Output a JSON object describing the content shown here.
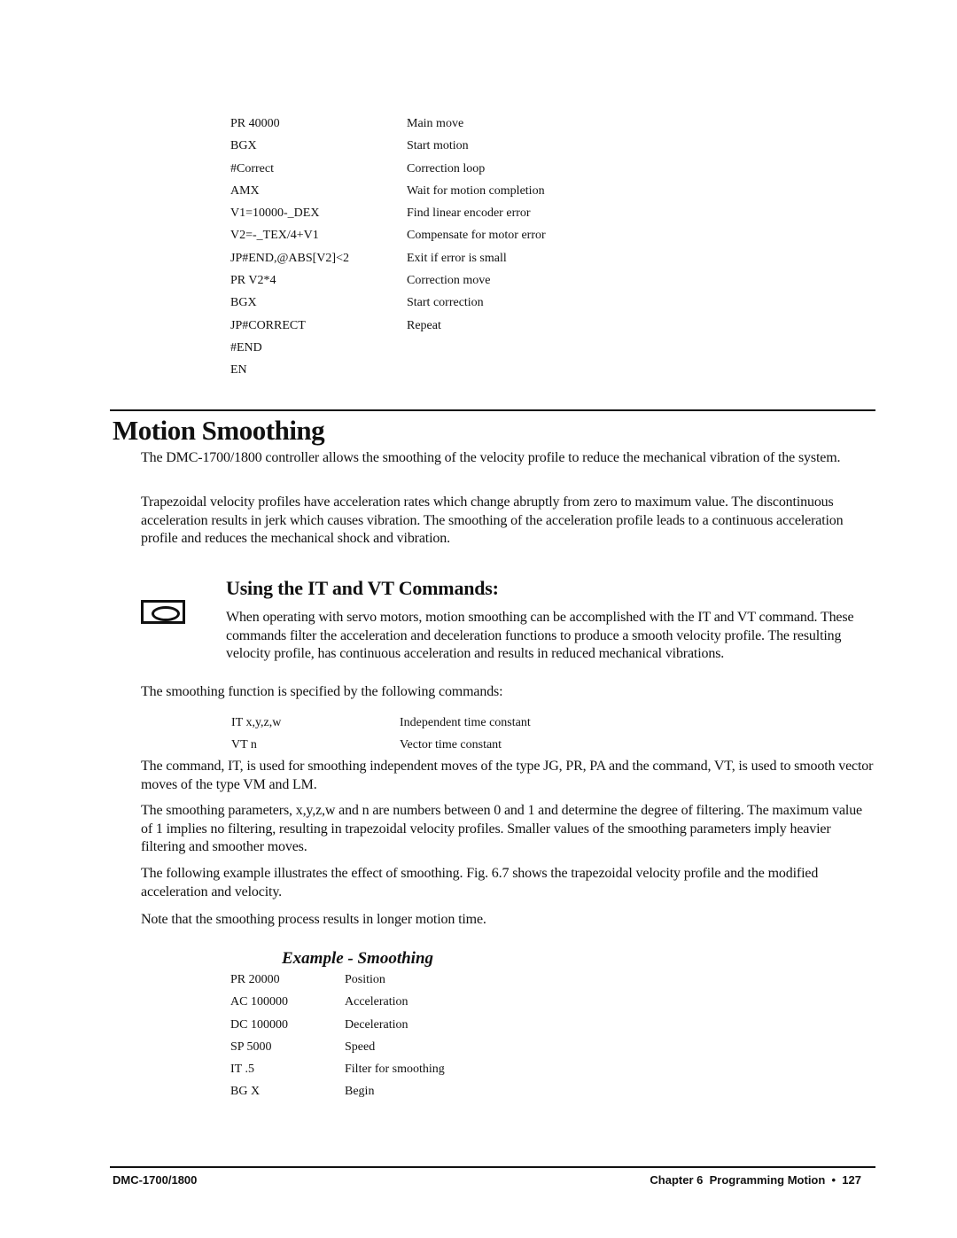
{
  "code_block_1": {
    "rows": [
      {
        "cmd": "PR 40000",
        "desc": "Main move"
      },
      {
        "cmd": "BGX",
        "desc": "Start motion"
      },
      {
        "cmd": "#Correct",
        "desc": "Correction loop"
      },
      {
        "cmd": "AMX",
        "desc": "Wait for motion completion"
      },
      {
        "cmd": "V1=10000-_DEX",
        "desc": "Find linear encoder error"
      },
      {
        "cmd": "V2=-_TEX/4+V1",
        "desc": "Compensate for motor error"
      },
      {
        "cmd": "JP#END,@ABS[V2]<2",
        "desc": "Exit if error is small"
      },
      {
        "cmd": "PR V2*4",
        "desc": "Correction move"
      },
      {
        "cmd": "BGX",
        "desc": "Start correction"
      },
      {
        "cmd": "JP#CORRECT",
        "desc": "Repeat"
      },
      {
        "cmd": "#END",
        "desc": ""
      },
      {
        "cmd": "EN",
        "desc": ""
      }
    ]
  },
  "section": {
    "title": "Motion Smoothing",
    "intro_paragraphs": [
      "The DMC-1700/1800 controller allows the smoothing of the velocity profile to reduce the mechanical vibration of the system.",
      "Trapezoidal velocity profiles have acceleration rates which change abruptly from zero to maximum value.  The discontinuous acceleration results in jerk which causes vibration.  The smoothing of the acceleration profile leads to a continuous acceleration profile and reduces the mechanical shock and vibration."
    ]
  },
  "subsection": {
    "title": "Using the IT and VT Commands:",
    "icon": "servo-motor-icon",
    "servo_paragraph": "When operating with servo motors, motion smoothing can be accomplished with the IT and VT command.  These commands  filter the acceleration and deceleration functions to produce a smooth velocity  profile.  The resulting velocity profile, has continuous acceleration and results in reduced mechanical vibrations.",
    "commands_intro": "The smoothing function is specified by the following commands:",
    "commands": [
      {
        "cmd": "IT x,y,z,w",
        "desc": "Independent time constant"
      },
      {
        "cmd": "VT n",
        "desc": "Vector time constant"
      }
    ],
    "paragraphs": [
      "The command, IT, is used for smoothing independent moves of the type JG, PR, PA and the command, VT, is used to smooth vector moves of the type VM and LM.",
      "The smoothing parameters, x,y,z,w and n are numbers between 0 and 1 and determine the degree of filtering.  The maximum value of 1 implies no filtering, resulting in trapezoidal velocity profiles.  Smaller values of the smoothing parameters imply heavier filtering and smoother moves.",
      "The following example illustrates the effect of smoothing.  Fig. 6.7 shows the trapezoidal velocity profile and the modified acceleration and velocity.",
      "Note that the smoothing process results in longer motion time."
    ]
  },
  "example": {
    "title": "Example - Smoothing",
    "rows": [
      {
        "cmd": "PR 20000",
        "desc": "Position"
      },
      {
        "cmd": "AC 100000",
        "desc": "Acceleration"
      },
      {
        "cmd": "DC 100000",
        "desc": "Deceleration"
      },
      {
        "cmd": "SP 5000",
        "desc": "Speed"
      },
      {
        "cmd": "IT .5",
        "desc": "Filter for smoothing"
      },
      {
        "cmd": "BG X",
        "desc": "Begin"
      }
    ]
  },
  "footer": {
    "left": "DMC-1700/1800",
    "right": "Chapter 6  Programming Motion  •  127"
  }
}
